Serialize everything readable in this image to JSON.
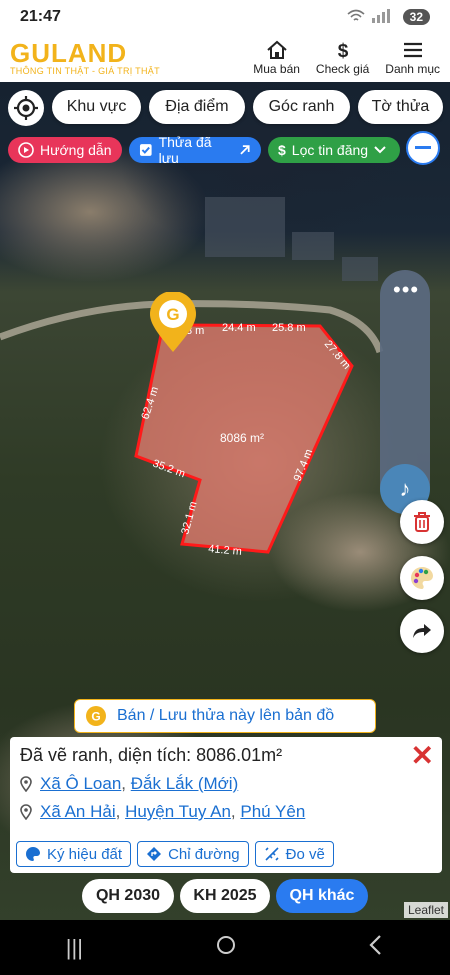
{
  "status_bar": {
    "time": "21:47",
    "battery": "32"
  },
  "header": {
    "logo_brand": "GULAND",
    "logo_tagline": "THÔNG TIN THẬT - GIÁ TRỊ THẬT",
    "nav": [
      {
        "label": "Mua bán",
        "icon": "house-icon"
      },
      {
        "label": "Check giá",
        "icon": "dollar-icon"
      },
      {
        "label": "Danh mục",
        "icon": "menu-icon"
      }
    ]
  },
  "filters": {
    "chips": [
      "Khu vực",
      "Địa điểm",
      "Góc ranh",
      "Tờ thửa"
    ],
    "pills": {
      "guide": "Hướng dẫn",
      "saved": "Thửa đã lưu",
      "filter": "Lọc tin đăng"
    }
  },
  "parcel": {
    "area_label": "8086 m²",
    "edge_labels": [
      "3 m",
      "24.4 m",
      "25.8 m",
      "27.8 m",
      "97.4 m",
      "41.2 m",
      "32.1 m",
      "35.2 m",
      "62.4 m"
    ],
    "fill_color": "#e87c70",
    "stroke_color": "#ff1a1a"
  },
  "banner": {
    "label": "Bán / Lưu thửa này lên bản đồ"
  },
  "info_card": {
    "title": "Đã vẽ ranh, diện tích: 8086.01m²",
    "location_new": {
      "commune": "Xã Ô Loan",
      "province": "Đắk Lắk (Mới)"
    },
    "location_old": {
      "commune": "Xã An Hải",
      "district": "Huyện Tuy An",
      "province": "Phú Yên"
    },
    "actions": [
      "Ký hiệu đất",
      "Chỉ đường",
      "Đo vẽ"
    ]
  },
  "plan_tabs": [
    "QH 2030",
    "KH 2025",
    "QH khác"
  ],
  "attribution": "Leaflet"
}
